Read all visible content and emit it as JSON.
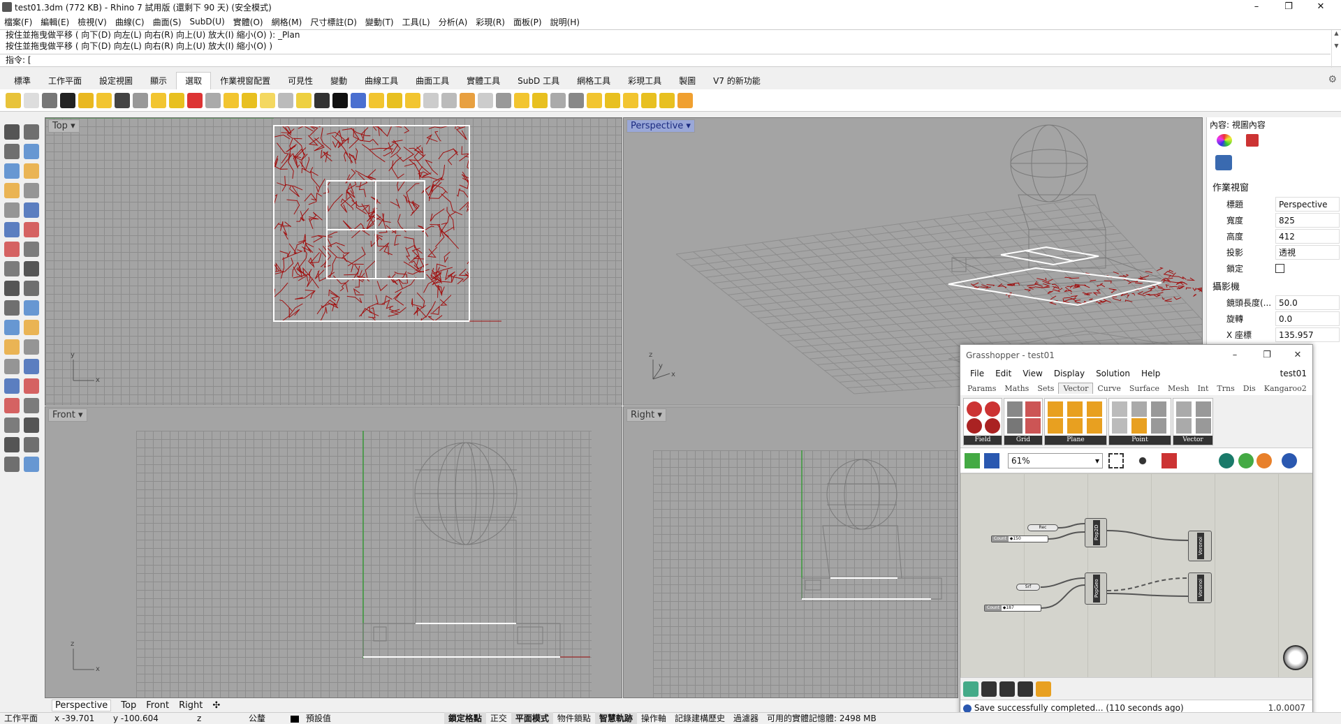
{
  "window": {
    "title": "test01.3dm (772 KB) - Rhino 7 試用版 (還剩下 90 天) (安全模式)",
    "min": "–",
    "max": "❐",
    "close": "✕"
  },
  "menu": [
    "檔案(F)",
    "編輯(E)",
    "檢視(V)",
    "曲線(C)",
    "曲面(S)",
    "SubD(U)",
    "實體(O)",
    "網格(M)",
    "尺寸標註(D)",
    "變動(T)",
    "工具(L)",
    "分析(A)",
    "彩現(R)",
    "面板(P)",
    "說明(H)"
  ],
  "command": {
    "history1": "按住並拖曳做平移 ( 向下(D) 向左(L) 向右(R) 向上(U) 放大(I) 縮小(O) ): _Plan",
    "history2": "按住並拖曳做平移 ( 向下(D) 向左(L) 向右(R) 向上(U) 放大(I) 縮小(O) )",
    "prompt": "指令: ["
  },
  "tabs": [
    "標準",
    "工作平面",
    "設定視圖",
    "顯示",
    "選取",
    "作業視窗配置",
    "可見性",
    "變動",
    "曲線工具",
    "曲面工具",
    "實體工具",
    "SubD 工具",
    "網格工具",
    "彩現工具",
    "製圖",
    "V7 的新功能"
  ],
  "active_tab": "選取",
  "viewports": {
    "top": "Top",
    "perspective": "Perspective",
    "front": "Front",
    "right": "Right",
    "axis_x": "x",
    "axis_y": "y",
    "axis_z": "z"
  },
  "viewport_tabs": [
    "Perspective",
    "Top",
    "Front",
    "Right"
  ],
  "viewport_tab_add": "✣",
  "status": {
    "cplane": "工作平面",
    "x": "x -39.701",
    "y": "y -100.604",
    "z": "z",
    "unit": "公釐",
    "layer": "預設值",
    "toggles": [
      "鎖定格點",
      "正交",
      "平面模式",
      "物件鎖點",
      "智慧軌跡",
      "操作軸",
      "記錄建構歷史",
      "過濾器"
    ],
    "memory": "可用的實體記憶體: 2498 MB"
  },
  "properties": {
    "header": "內容: 視圖內容",
    "section_viewport": "作業視窗",
    "rows": [
      {
        "label": "標題",
        "value": "Perspective"
      },
      {
        "label": "寬度",
        "value": "825"
      },
      {
        "label": "高度",
        "value": "412"
      },
      {
        "label": "投影",
        "value": "透視"
      },
      {
        "label": "鎖定",
        "value": ""
      }
    ],
    "section_camera": "攝影機",
    "camera_rows": [
      {
        "label": "鏡頭長度(...",
        "value": "50.0"
      },
      {
        "label": "旋轉",
        "value": "0.0"
      },
      {
        "label": "X 座標",
        "value": "135.957"
      }
    ]
  },
  "grasshopper": {
    "title": "Grasshopper - test01",
    "doc": "test01",
    "menu": [
      "File",
      "Edit",
      "View",
      "Display",
      "Solution",
      "Help"
    ],
    "tabs": [
      "Params",
      "Maths",
      "Sets",
      "Vector",
      "Curve",
      "Surface",
      "Mesh",
      "Int",
      "Trns",
      "Dis",
      "Kangaroo2"
    ],
    "active_tab": "Vector",
    "groups": [
      "Field",
      "Grid",
      "Plane",
      "Point",
      "Vector"
    ],
    "zoom": "61%",
    "components": {
      "rec": "Rec",
      "count1": "Count",
      "count1_val": "◆150",
      "pop2d": "Pop2D",
      "voronoi1": "Voronoi",
      "srf": "Srf",
      "count2": "Count",
      "count2_val": "◆187",
      "popgeo": "PopGeo",
      "voronoi2": "Voronoi"
    },
    "status": "Save successfully completed... (110 seconds ago)",
    "version": "1.0.0007"
  },
  "colors": {
    "viewport_bg": "#a4a4a4",
    "voronoi_red": "#a01010",
    "wire": "#7a7a7a"
  }
}
